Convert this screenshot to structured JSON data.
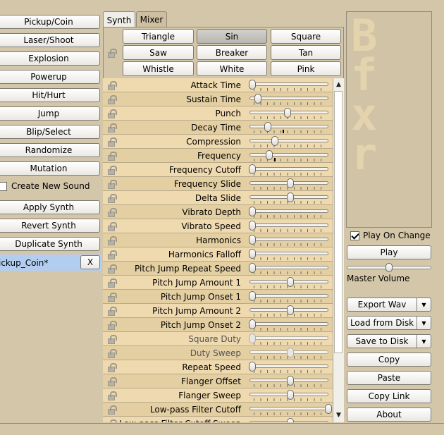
{
  "left_panel": {
    "generators": [
      "Pickup/Coin",
      "Laser/Shoot",
      "Explosion",
      "Powerup",
      "Hit/Hurt",
      "Jump",
      "Blip/Select",
      "Randomize",
      "Mutation"
    ],
    "create_new_sound": {
      "label": "Create New Sound",
      "checked": false
    },
    "actions": [
      "Apply Synth",
      "Revert Synth",
      "Duplicate Synth"
    ],
    "sound_list": [
      {
        "name": "ickup_Coin*",
        "remove_label": "X"
      }
    ]
  },
  "tabs": [
    {
      "label": "Synth",
      "active": true
    },
    {
      "label": "Mixer",
      "active": false
    }
  ],
  "waveforms": {
    "items": [
      "Triangle",
      "Sin",
      "Square",
      "Saw",
      "Breaker",
      "Tan",
      "Whistle",
      "White",
      "Pink"
    ],
    "selected": "Sin"
  },
  "params": [
    {
      "label": "Attack Time",
      "value": 0.0,
      "disabled": false
    },
    {
      "label": "Sustain Time",
      "value": 0.07,
      "disabled": false,
      "zero_marker": false
    },
    {
      "label": "Punch",
      "value": 0.46,
      "disabled": false
    },
    {
      "label": "Decay Time",
      "value": 0.2,
      "disabled": false,
      "marker": 0.4
    },
    {
      "label": "Compression",
      "value": 0.3,
      "disabled": false
    },
    {
      "label": "Frequency",
      "value": 0.22,
      "disabled": false,
      "marker": 0.29
    },
    {
      "label": "Frequency Cutoff",
      "value": 0.0,
      "disabled": false
    },
    {
      "label": "Frequency Slide",
      "value": 0.5,
      "disabled": false
    },
    {
      "label": "Delta Slide",
      "value": 0.5,
      "disabled": false
    },
    {
      "label": "Vibrato Depth",
      "value": 0.0,
      "disabled": false
    },
    {
      "label": "Vibrato Speed",
      "value": 0.0,
      "disabled": false
    },
    {
      "label": "Harmonics",
      "value": 0.0,
      "disabled": false
    },
    {
      "label": "Harmonics Falloff",
      "value": 0.0,
      "disabled": false
    },
    {
      "label": "Pitch Jump Repeat Speed",
      "value": 0.0,
      "disabled": false
    },
    {
      "label": "Pitch Jump Amount 1",
      "value": 0.5,
      "disabled": false
    },
    {
      "label": "Pitch Jump Onset 1",
      "value": 0.0,
      "disabled": false
    },
    {
      "label": "Pitch Jump Amount 2",
      "value": 0.5,
      "disabled": false
    },
    {
      "label": "Pitch Jump Onset 2",
      "value": 0.0,
      "disabled": false
    },
    {
      "label": "Square Duty",
      "value": 0.0,
      "disabled": true
    },
    {
      "label": "Duty Sweep",
      "value": 0.5,
      "disabled": true
    },
    {
      "label": "Repeat Speed",
      "value": 0.0,
      "disabled": false
    },
    {
      "label": "Flanger Offset",
      "value": 0.5,
      "disabled": false
    },
    {
      "label": "Flanger Sweep",
      "value": 0.5,
      "disabled": false
    },
    {
      "label": "Low-pass Filter Cutoff",
      "value": 1.0,
      "disabled": false
    },
    {
      "label": "Low-pass Filter Cutoff Sweep",
      "value": 0.5,
      "disabled": false
    }
  ],
  "logo": {
    "text": "Bfxr"
  },
  "right_panel": {
    "play_on_change": {
      "label": "Play On Change",
      "checked": true
    },
    "play_label": "Play",
    "master_volume": {
      "label": "Master Volume",
      "value": 0.5
    },
    "export_label": "Export Wav",
    "load_label": "Load from Disk",
    "save_label": "Save to Disk",
    "copy_label": "Copy",
    "paste_label": "Paste",
    "copy_link_label": "Copy Link",
    "about_label": "About",
    "dropdown_icon": "triangle-down-icon"
  },
  "scrollbar": {
    "up_icon": "▲",
    "down_icon": "▼"
  }
}
